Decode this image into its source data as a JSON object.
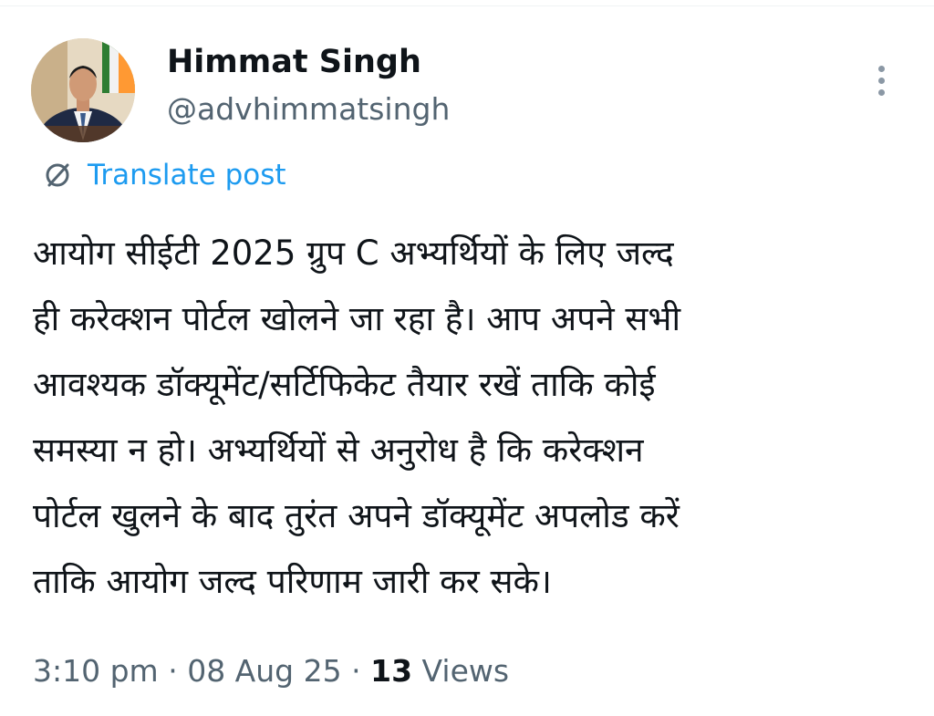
{
  "author": {
    "display_name": "Himmat Singh",
    "handle": "@advhimmatsingh"
  },
  "translate": {
    "label": "Translate post",
    "icon": "translate-globe-icon",
    "color": "#1d9bf0"
  },
  "post": {
    "lines": [
      "आयोग सीईटी 2025 ग्रुप C अभ्यर्थियों के लिए जल्द",
      "ही करेक्शन पोर्टल खोलने जा रहा है। आप अपने सभी",
      "आवश्यक डॉक्यूमेंट/सर्टिफिकेट तैयार रखें ताकि कोई",
      "समस्या न हो। अभ्यर्थियों से अनुरोध है कि करेक्शन",
      "पोर्टल खुलने के बाद तुरंत अपने डॉक्यूमेंट अपलोड करें",
      "ताकि आयोग जल्द परिणाम जारी कर सके।"
    ]
  },
  "meta": {
    "time": "3:10 pm",
    "separator": "·",
    "date": "08 Aug 25",
    "views_count": "13",
    "views_label": "Views"
  },
  "menu": {
    "icon": "more-vertical-icon"
  }
}
